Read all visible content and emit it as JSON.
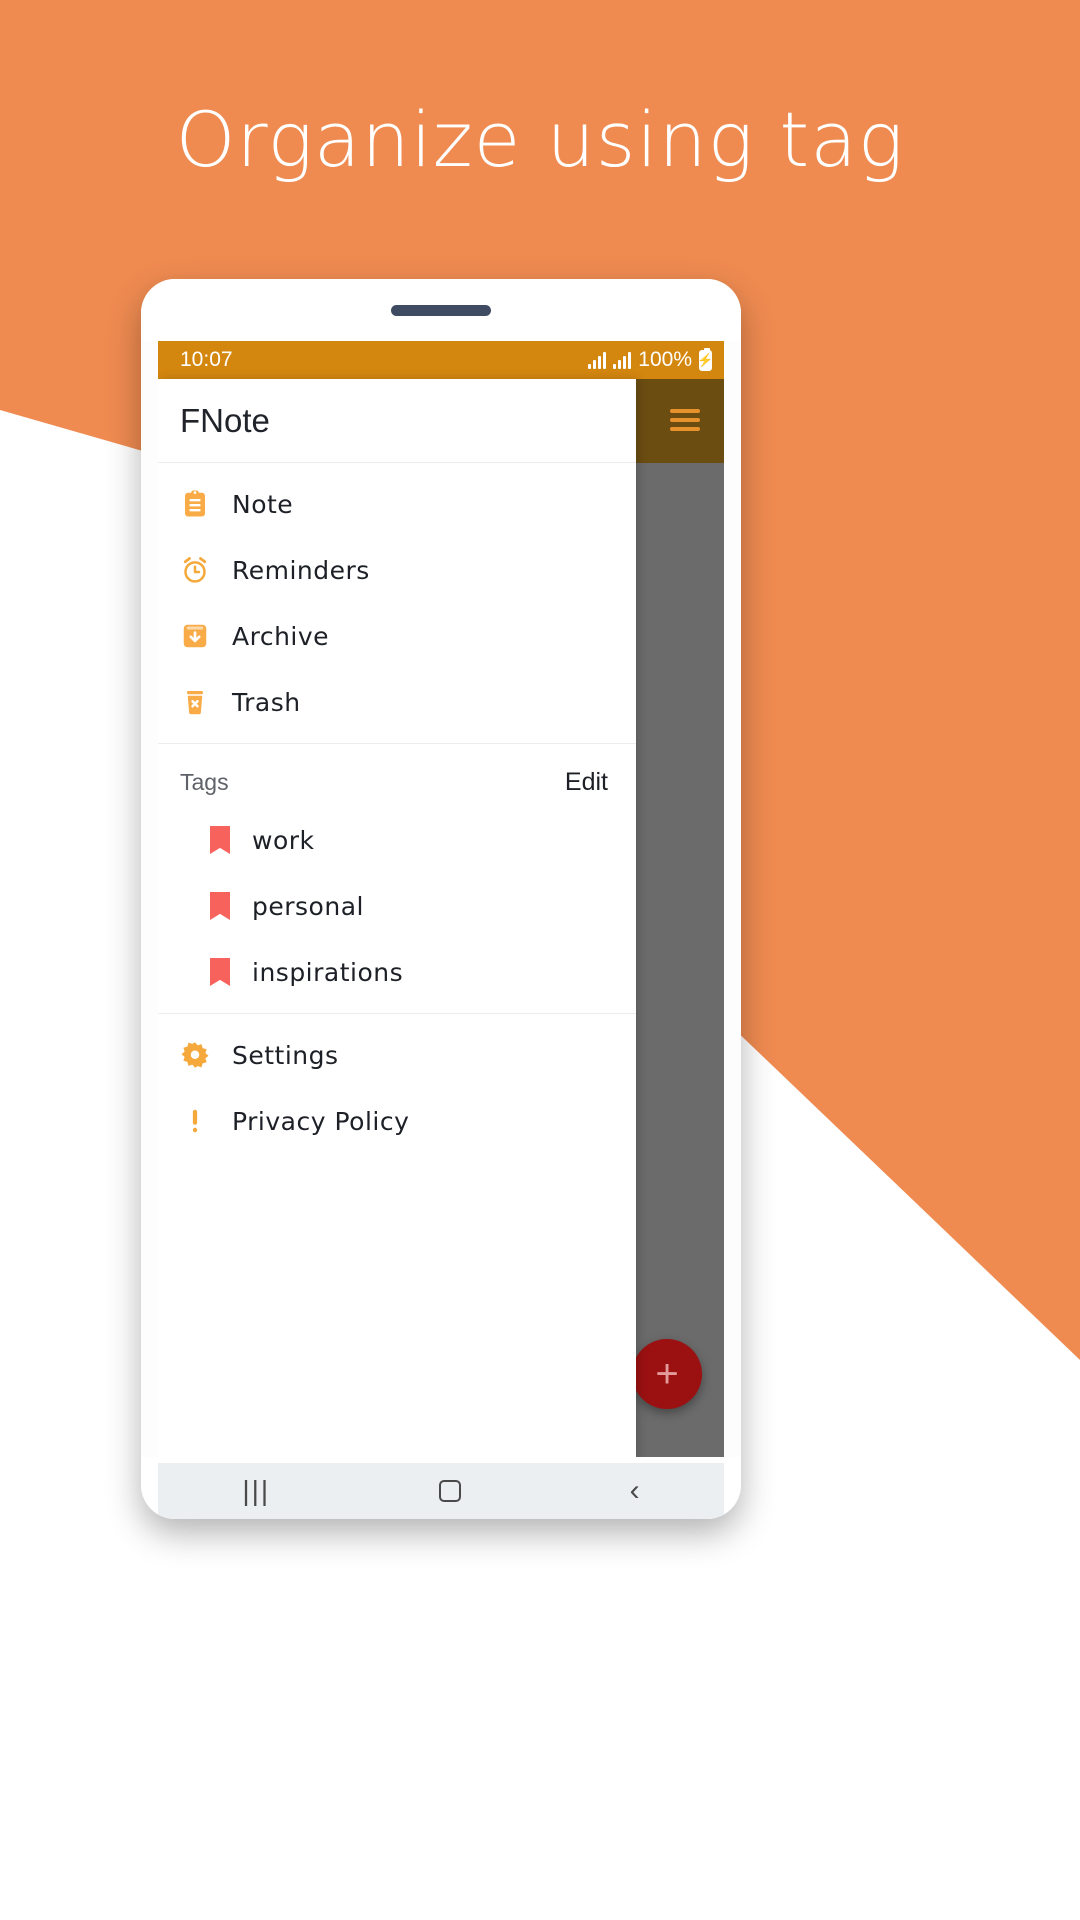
{
  "hero": {
    "title": "Organize using tag",
    "background_color": "#ef8b51"
  },
  "phone": {
    "statusbar": {
      "time": "10:07",
      "battery_text": "100%",
      "background_color": "#d4870f",
      "icons": [
        "signal-icon",
        "signal-icon",
        "battery-charging-icon"
      ]
    },
    "drawer": {
      "app_title": "FNote",
      "nav_items": [
        {
          "label": "Note",
          "icon": "clipboard-icon"
        },
        {
          "label": "Reminders",
          "icon": "alarm-clock-icon"
        },
        {
          "label": "Archive",
          "icon": "archive-box-icon"
        },
        {
          "label": "Trash",
          "icon": "trash-icon"
        }
      ],
      "tags_header": {
        "title": "Tags",
        "edit_label": "Edit"
      },
      "tags": [
        {
          "label": "work",
          "icon": "bookmark-icon",
          "color": "#f8625c"
        },
        {
          "label": "personal",
          "icon": "bookmark-icon",
          "color": "#f8625c"
        },
        {
          "label": "inspirations",
          "icon": "bookmark-icon",
          "color": "#f8625c"
        }
      ],
      "footer_items": [
        {
          "label": "Settings",
          "icon": "gear-icon"
        },
        {
          "label": "Privacy Policy",
          "icon": "exclamation-icon"
        }
      ]
    },
    "overlay": {
      "menu_icon": "hamburger-menu-icon",
      "fab_label": "+",
      "fab_color": "#9b1111"
    },
    "navbar": {
      "recents_label": "|||",
      "home_icon": "home-square-icon",
      "back_label": "‹"
    }
  },
  "theme": {
    "accent": "#f5a93c",
    "tag_color": "#f8625c",
    "status_bar": "#d4870f"
  }
}
